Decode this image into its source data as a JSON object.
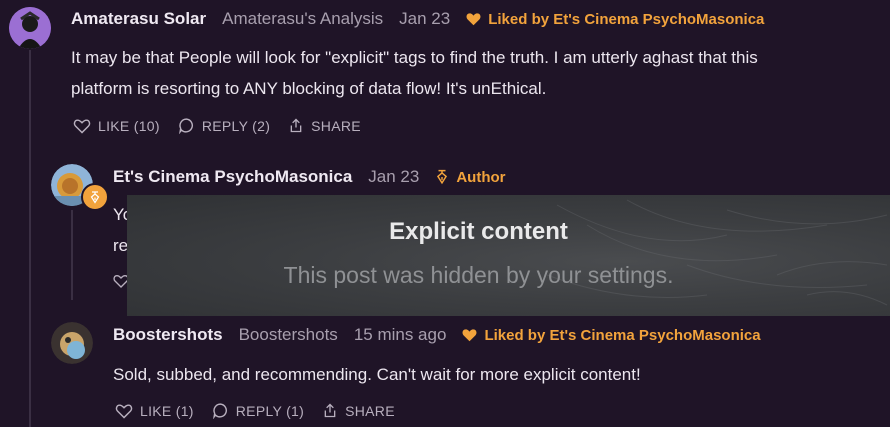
{
  "comments": [
    {
      "author": "Amaterasu Solar",
      "publication": "Amaterasu's Analysis",
      "date": "Jan 23",
      "liked_by": "Liked by Et's Cinema PsychoMasonica",
      "body_line1": "It may be that People will look for \"explicit\" tags to find the truth. I am utterly aghast that this",
      "body_line2": "platform is resorting to ANY blocking of data flow! It's unEthical.",
      "like_label": "LIKE (10)",
      "reply_label": "REPLY (2)",
      "share_label": "SHARE"
    },
    {
      "author": "Et's Cinema PsychoMasonica",
      "date": "Jan 23",
      "badge": "Author",
      "peek_line1": "Yo",
      "peek_line2": "re"
    },
    {
      "author": "Boostershots",
      "publication": "Boostershots",
      "date": "15 mins ago",
      "liked_by": "Liked by Et's Cinema PsychoMasonica",
      "body_line1": "Sold, subbed, and recommending. Can't wait for more explicit content!",
      "like_label": "LIKE (1)",
      "reply_label": "REPLY (1)",
      "share_label": "SHARE"
    }
  ],
  "hidden_notice": {
    "title": "Explicit content",
    "subtitle": "This post was hidden by your settings."
  },
  "colors": {
    "background": "#1f1427",
    "accent": "#f2a33c",
    "muted": "#a89fae"
  },
  "icons": [
    "heart-icon",
    "comment-icon",
    "share-icon",
    "pen-nib-icon"
  ]
}
